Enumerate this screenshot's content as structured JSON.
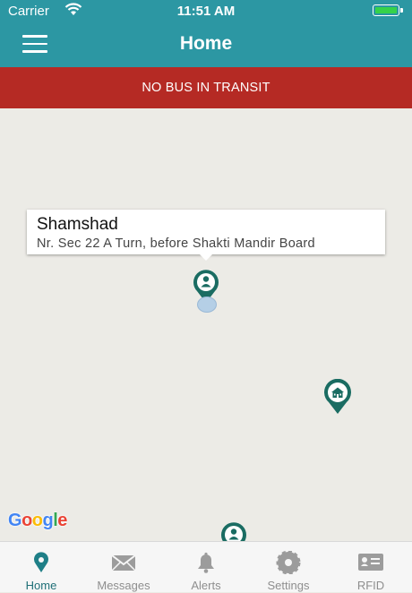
{
  "status_bar": {
    "carrier": "Carrier",
    "time": "11:51 AM"
  },
  "header": {
    "title": "Home"
  },
  "banner": {
    "text": "NO BUS IN TRANSIT"
  },
  "map": {
    "callout": {
      "name": "Shamshad",
      "address": "Nr. Sec 22 A Turn, before Shakti Mandir Board"
    },
    "attribution": "Google",
    "colors": {
      "pin": "#1a6c62",
      "background": "#ecebe6"
    }
  },
  "tabs": [
    {
      "label": "Home",
      "icon": "location-pin-icon",
      "active": true
    },
    {
      "label": "Messages",
      "icon": "envelope-icon"
    },
    {
      "label": "Alerts",
      "icon": "bell-icon"
    },
    {
      "label": "Settings",
      "icon": "gear-icon"
    },
    {
      "label": "RFID",
      "icon": "id-card-icon"
    }
  ],
  "colors": {
    "accent": "#2c97a3",
    "banner": "#b52a24",
    "battery": "#35d24a"
  }
}
